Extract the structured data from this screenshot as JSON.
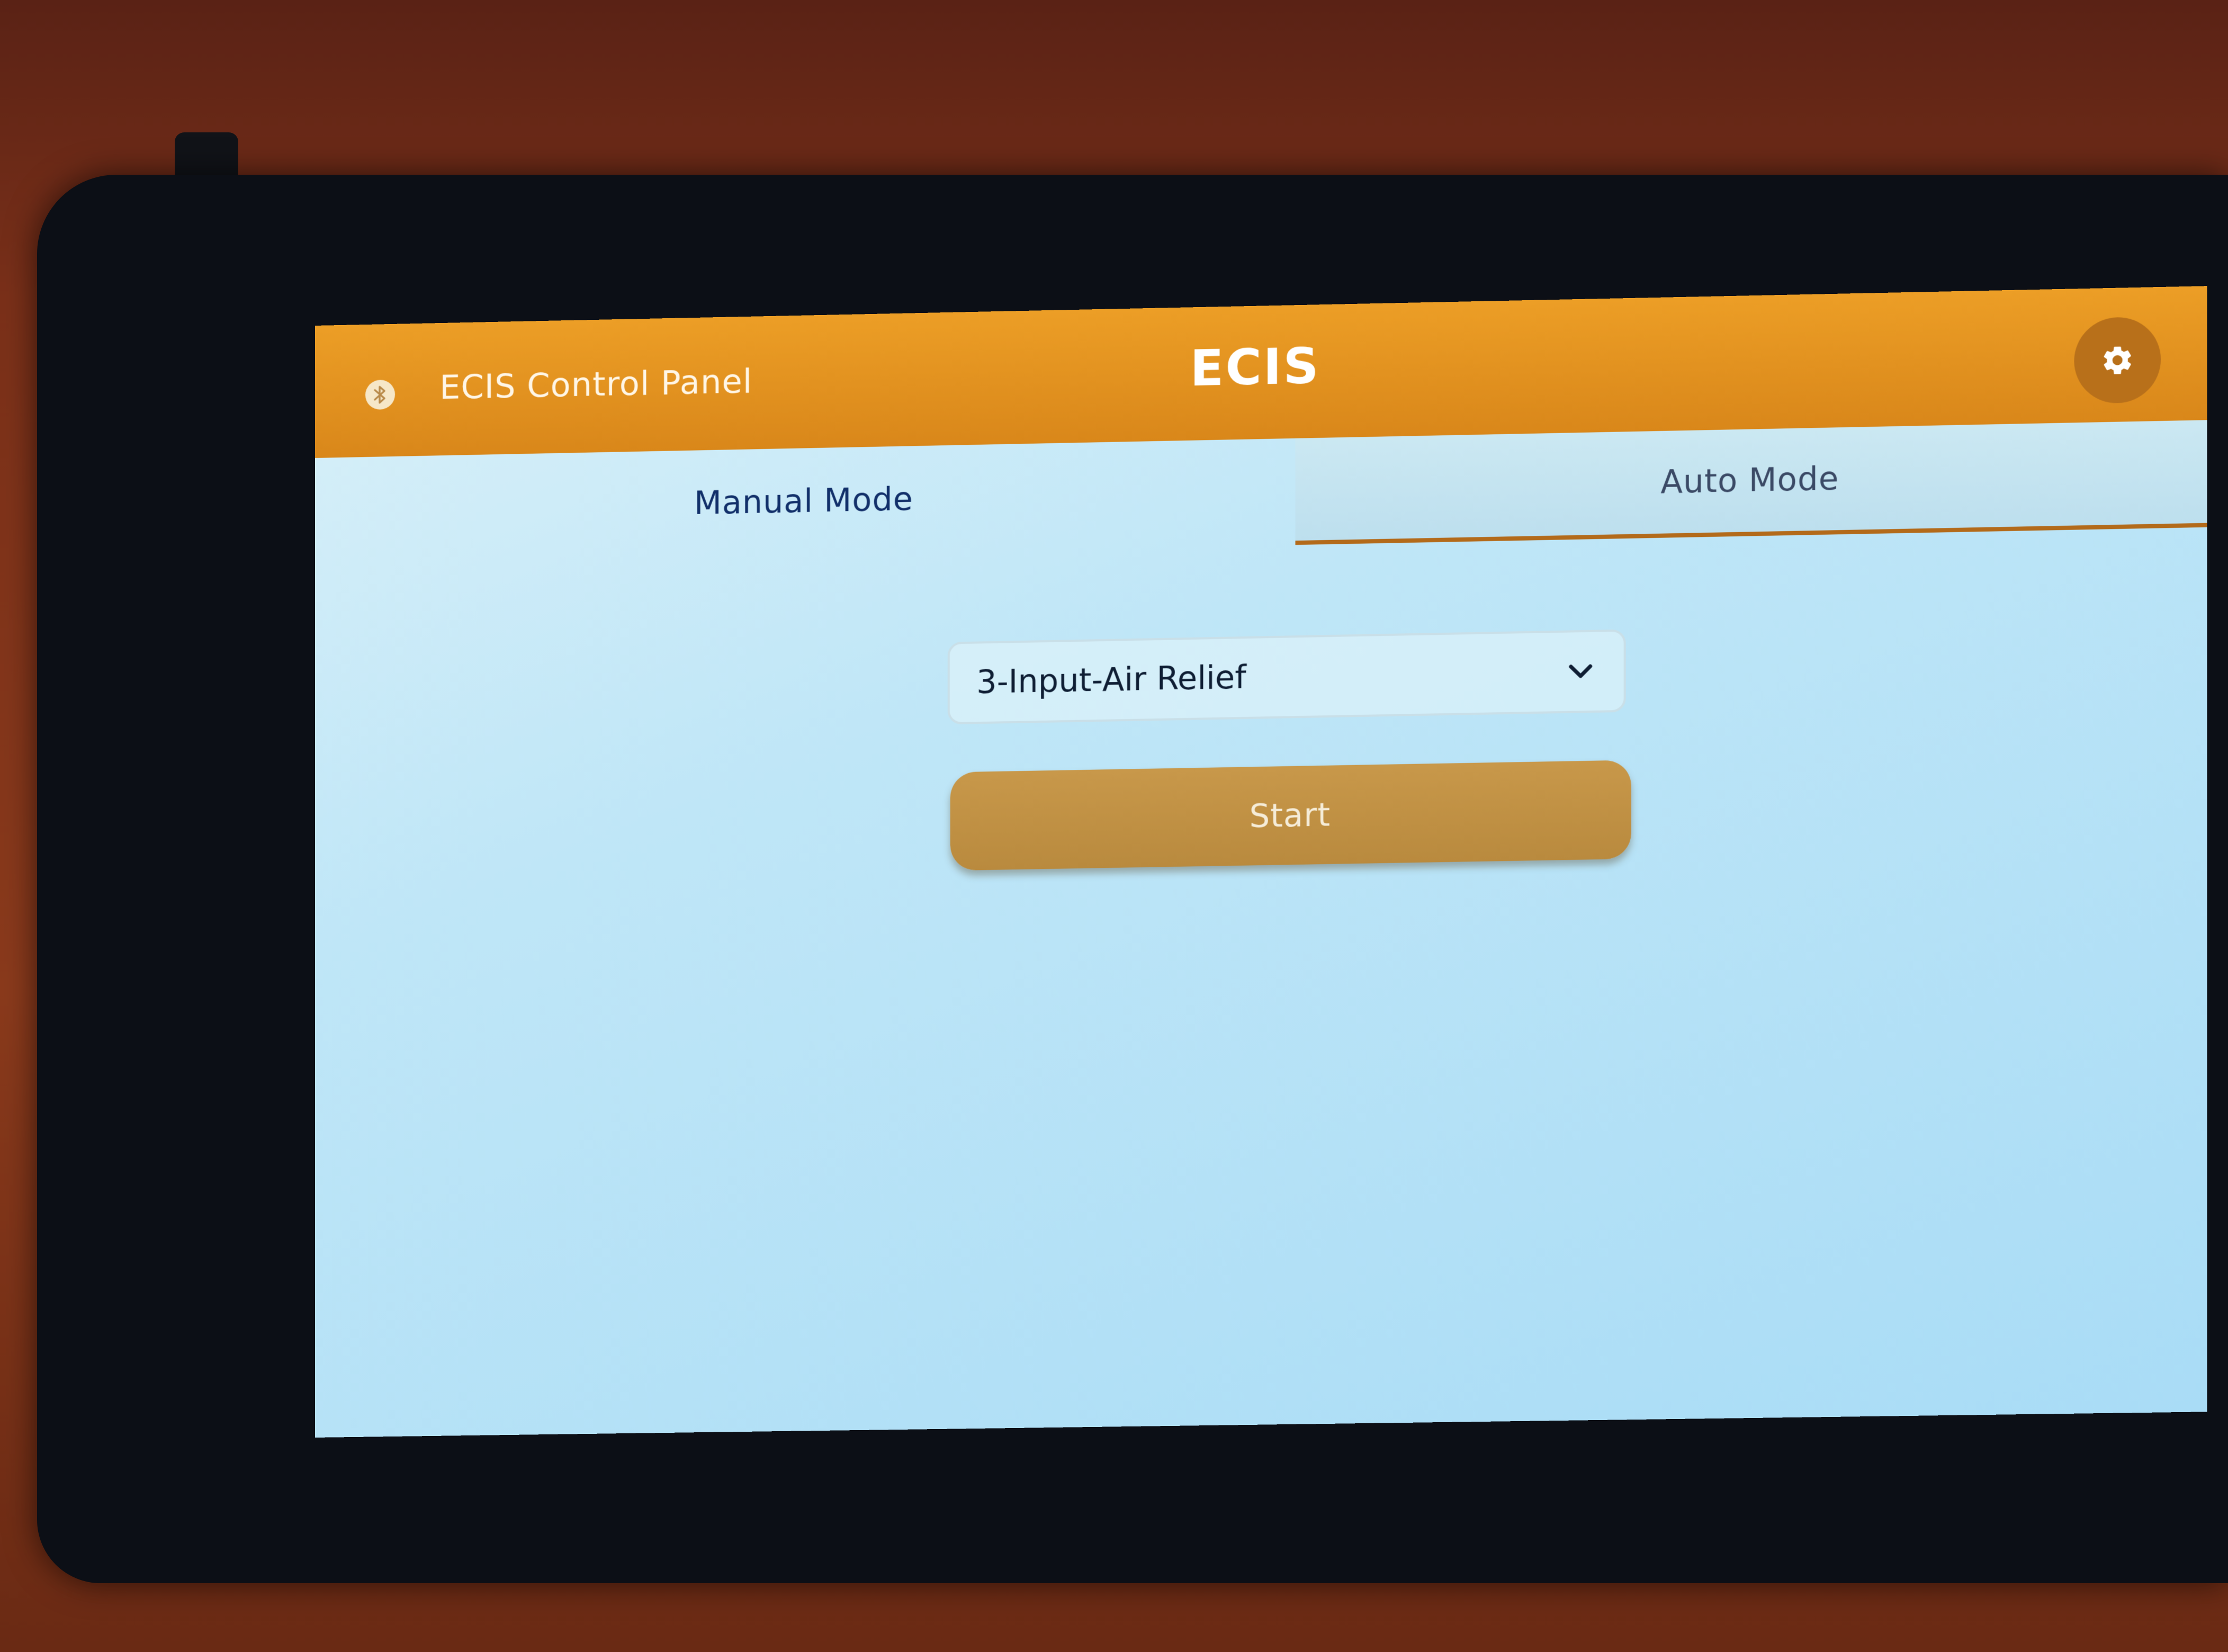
{
  "header": {
    "panel_label": "ECIS Control Panel",
    "title": "ECIS",
    "bluetooth_icon": "bluetooth-icon",
    "settings_icon": "gear-icon"
  },
  "tabs": [
    {
      "label": "Manual Mode",
      "active": true
    },
    {
      "label": "Auto Mode",
      "active": false
    }
  ],
  "mode_select": {
    "value": "3-Input-Air Relief",
    "icon": "chevron-down-icon"
  },
  "start_button": {
    "label": "Start"
  },
  "colors": {
    "header": "#e2921f",
    "screen": "#bfe6f7",
    "button": "#c0913f",
    "active_tab_text": "#12306a",
    "tab_underline": "#b36a1a"
  }
}
